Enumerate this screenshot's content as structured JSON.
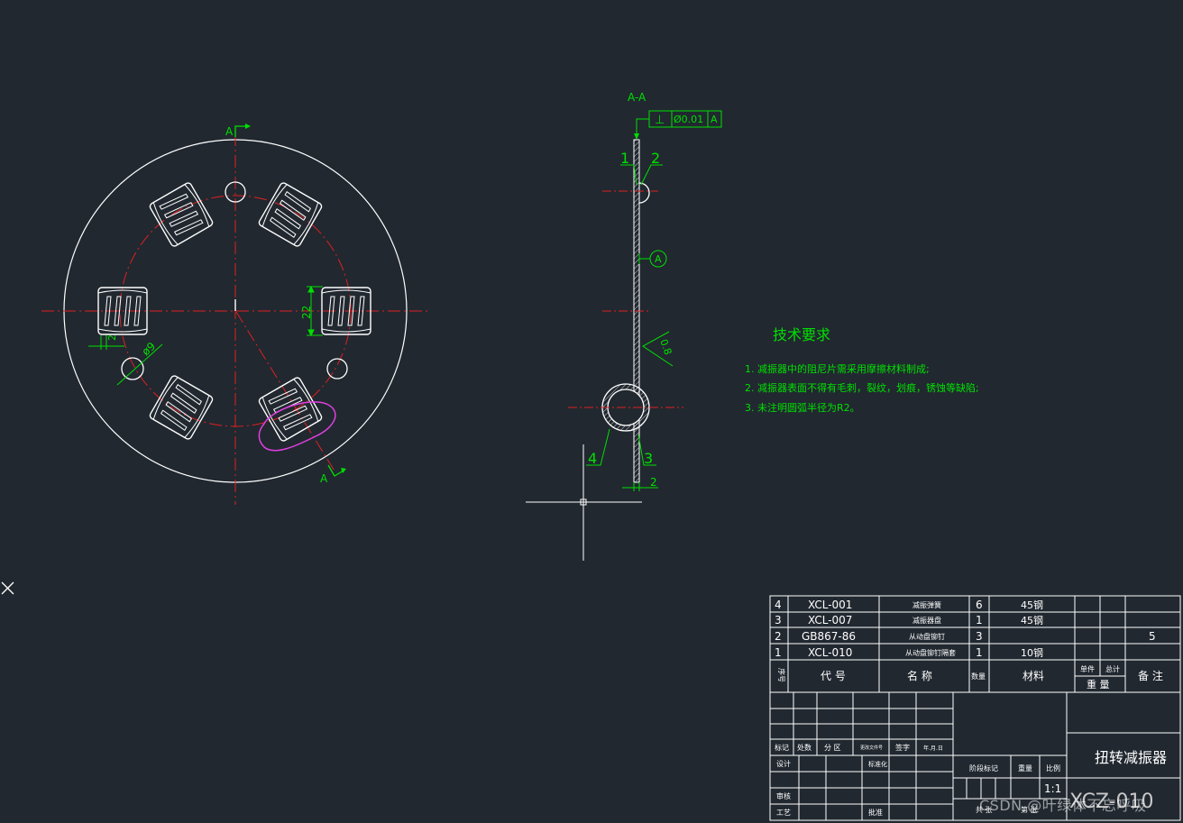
{
  "colors": {
    "background": "#212830",
    "geometry": "#ffffff",
    "annotation": "#00e000",
    "centerline": "#e02020",
    "highlight": "#e040e0"
  },
  "view_plan": {
    "section_mark_top": "A",
    "section_mark_bottom": "A",
    "dim_spring_height": "22",
    "dim_spring_width": "2",
    "dim_hole": "ø9"
  },
  "view_section": {
    "title": "A-A",
    "tolerance": {
      "symbol": "⊥",
      "value": "Ø0.01",
      "datum": "A"
    },
    "datum_label": "A",
    "roughness": "0.8",
    "balloons": [
      "1",
      "2",
      "3",
      "4"
    ],
    "thickness_dim": "2"
  },
  "tech": {
    "title": "技术要求",
    "items": [
      "1. 减振器中的阻尼片需采用摩擦材料制成;",
      "2. 减振器表面不得有毛刺，裂纹，划痕，锈蚀等缺陷;",
      "3. 未注明圆弧半径为R2。"
    ]
  },
  "bom": {
    "rows": [
      {
        "no": "4",
        "code": "XCL-001",
        "name": "减振弹簧",
        "qty": "6",
        "material": "45钢",
        "unit_wt": "",
        "total_wt": "",
        "note": ""
      },
      {
        "no": "3",
        "code": "XCL-007",
        "name": "减振器盘",
        "qty": "1",
        "material": "45钢",
        "unit_wt": "",
        "total_wt": "",
        "note": ""
      },
      {
        "no": "2",
        "code": "GB867-86",
        "name": "从动盘铆钉",
        "qty": "3",
        "material": "",
        "unit_wt": "",
        "total_wt": "",
        "note": "5"
      },
      {
        "no": "1",
        "code": "XCL-010",
        "name": "从动盘铆钉隔套",
        "qty": "1",
        "material": "10钢",
        "unit_wt": "",
        "total_wt": "",
        "note": ""
      }
    ],
    "header": {
      "no": "序号",
      "code": "代  号",
      "name": "名  称",
      "qty": "数量",
      "material": "材料",
      "unit": "单件",
      "total": "总计",
      "weight": "重  量",
      "note": "备  注"
    }
  },
  "title_block": {
    "labels": {
      "mark": "标记",
      "count": "处数",
      "zone": "分 区",
      "change_doc": "更改文件号",
      "sign": "签字",
      "date": "年.月.日",
      "design": "设计",
      "standard": "标准化",
      "check": "审核",
      "process": "工艺",
      "approve": "批准",
      "stage": "阶段标记",
      "weight": "重量",
      "scale": "比例",
      "sheets": "共 张",
      "sheet": "第 张"
    },
    "part_name": "扭转减振器",
    "scale_value": "1:1",
    "drawing_no": "XCZ-010"
  },
  "watermark": "CSDN @叶绿体不忘呼吸"
}
